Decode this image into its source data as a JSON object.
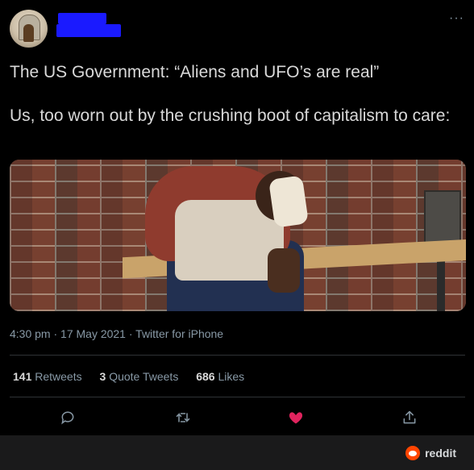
{
  "tweet": {
    "text_line1": "The US Government: “Aliens and UFO’s are real”",
    "text_line2": "Us, too worn out by the crushing boot of capitalism to care:",
    "meta": "4:30 pm · 17 May 2021 · Twitter for iPhone",
    "retweets_count": "141",
    "retweets_label": "Retweets",
    "quote_tweets_count": "3",
    "quote_tweets_label": "Quote Tweets",
    "likes_count": "686",
    "likes_label": "Likes",
    "more_label": "···"
  },
  "footer": {
    "brand": "reddit"
  },
  "colors": {
    "background": "#000000",
    "text": "#d9d9d9",
    "muted": "#8899a6",
    "like_active": "#e0245e",
    "redaction": "#1a1aff",
    "reddit_orange": "#ff4500"
  },
  "icons": {
    "reply": "reply-icon",
    "retweet": "retweet-icon",
    "like": "heart-icon",
    "share": "share-icon",
    "reddit": "reddit-logo-icon"
  }
}
